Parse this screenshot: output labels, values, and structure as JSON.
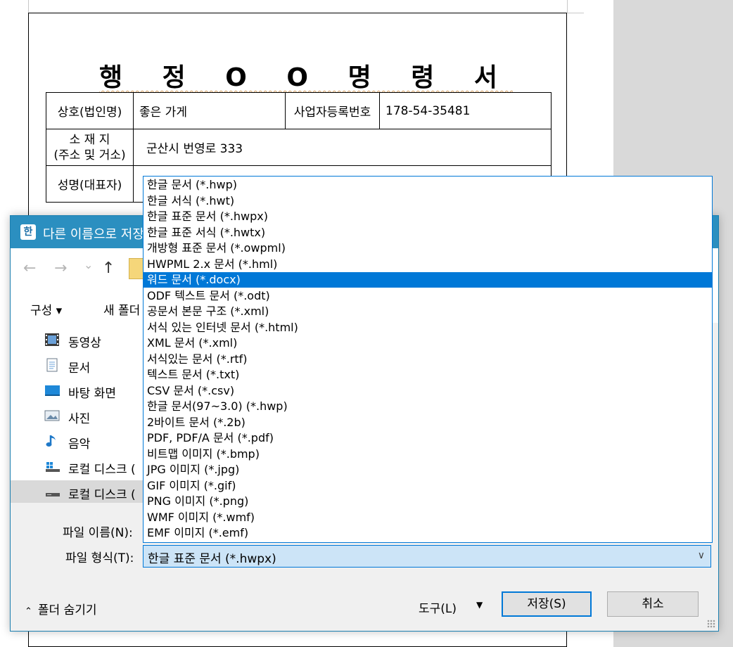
{
  "document": {
    "title": "행 정 O O 명 령 서",
    "rows": [
      {
        "label": "상호(법인명)",
        "value": "좋은 가게",
        "label2": "사업자등록번호",
        "value2": "178-54-35481"
      },
      {
        "label_line1": "소 재 지",
        "label_line2": "(주소 및 거소)",
        "value": "군산시 번영로 333"
      },
      {
        "label": "성명(대표자)",
        "value": ""
      }
    ]
  },
  "dialog": {
    "app_icon": "한",
    "title": "다른 이름으로 저장",
    "nav": {
      "back": "←",
      "forward": "→",
      "dropdown": "⌄",
      "up": "↑"
    },
    "command_bar": {
      "organize": "구성 ▾",
      "new_folder": "새 폴더"
    },
    "nav_items": [
      {
        "label": "동영상",
        "icon": "video-icon"
      },
      {
        "label": "문서",
        "icon": "document-icon"
      },
      {
        "label": "바탕 화면",
        "icon": "desktop-icon"
      },
      {
        "label": "사진",
        "icon": "picture-icon"
      },
      {
        "label": "음악",
        "icon": "music-icon"
      },
      {
        "label": "로컬 디스크 (",
        "icon": "drive-icon"
      },
      {
        "label": "로컬 디스크 (",
        "icon": "drive-icon",
        "selected": true
      }
    ],
    "file_name_label": "파일 이름(N):",
    "file_type_label": "파일 형식(T):",
    "file_type_value": "한글 표준 문서 (*.hwpx)",
    "hide_folders": "폴더 숨기기",
    "tools": "도구(L)",
    "save": "저장(S)",
    "cancel": "취소"
  },
  "dropdown": {
    "selected_index": 6,
    "items": [
      "한글 문서 (*.hwp)",
      "한글 서식 (*.hwt)",
      "한글 표준 문서 (*.hwpx)",
      "한글 표준 서식 (*.hwtx)",
      "개방형 표준 문서 (*.owpml)",
      "HWPML 2.x 문서 (*.hml)",
      "워드 문서 (*.docx)",
      "ODF 텍스트 문서 (*.odt)",
      "공문서 본문 구조 (*.xml)",
      "서식 있는 인터넷 문서 (*.html)",
      "XML 문서 (*.xml)",
      "서식있는 문서 (*.rtf)",
      "텍스트 문서 (*.txt)",
      "CSV 문서 (*.csv)",
      "한글 문서(97~3.0) (*.hwp)",
      "2바이트 문서 (*.2b)",
      "PDF, PDF/A 문서 (*.pdf)",
      "비트맵 이미지 (*.bmp)",
      "JPG 이미지 (*.jpg)",
      "GIF 이미지 (*.gif)",
      "PNG 이미지 (*.png)",
      "WMF 이미지 (*.wmf)",
      "EMF 이미지 (*.emf)"
    ]
  }
}
